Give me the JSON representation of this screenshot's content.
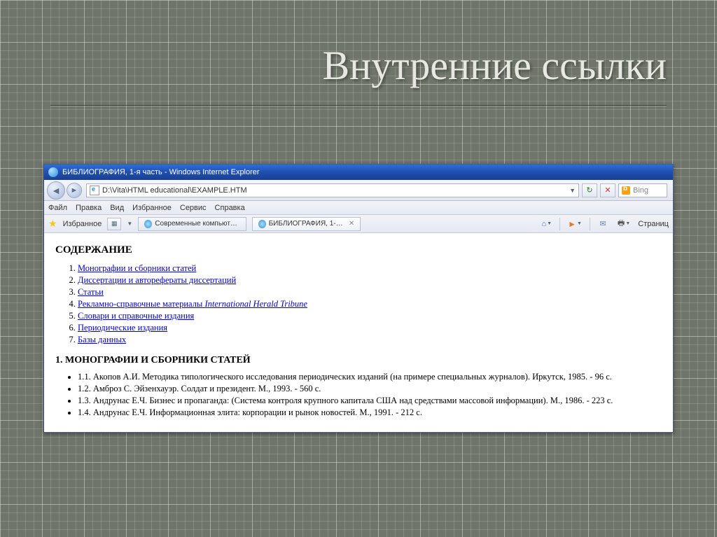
{
  "slide": {
    "title": "Внутренние ссылки"
  },
  "ie": {
    "window_title": "БИБЛИОГРАФИЯ, 1-я часть - Windows Internet Explorer",
    "address": "D:\\Vita\\HTML educational\\EXAMPLE.HTM",
    "search_engine": "Bing",
    "menu": {
      "file": "Файл",
      "edit": "Правка",
      "view": "Вид",
      "favorites": "Избранное",
      "tools": "Сервис",
      "help": "Справка"
    },
    "favorites_label": "Избранное",
    "tabs": {
      "bg": "Современные компьютерн...",
      "active": "БИБЛИОГРАФИЯ, 1-я ча..."
    },
    "right_label": "Страниц"
  },
  "page": {
    "contents_heading": "СОДЕРЖАНИЕ",
    "toc": {
      "i1": "Монографии и сборники статей",
      "i2": "Диссертации и авторефераты диссертаций",
      "i3": "Статьи",
      "i4_a": "Рекламно-справочные материалы ",
      "i4_b": "International Herald Tribune",
      "i5": "Словари и справочные издания",
      "i6": "Периодические издания",
      "i7": "Базы данных"
    },
    "section1_heading": "1. МОНОГРАФИИ И СБОРНИКИ СТАТЕЙ",
    "bib": {
      "b1": "1.1. Акопов А.И. Методика типологического исследования периодических изданий (на примере специальных журналов). Иркутск, 1985. - 96 с.",
      "b2": "1.2. Амброз С. Эйзенхауэр. Солдат и президент. М., 1993. - 560 с.",
      "b3": "1.3. Андрунас Е.Ч. Бизнес и пропаганда: (Система контроля крупного капитала США над средствами массовой информации). М., 1986. - 223 с.",
      "b4": "1.4. Андрунас Е.Ч. Информационная элита: корпорации и рынок новостей. М., 1991. - 212 с."
    }
  }
}
